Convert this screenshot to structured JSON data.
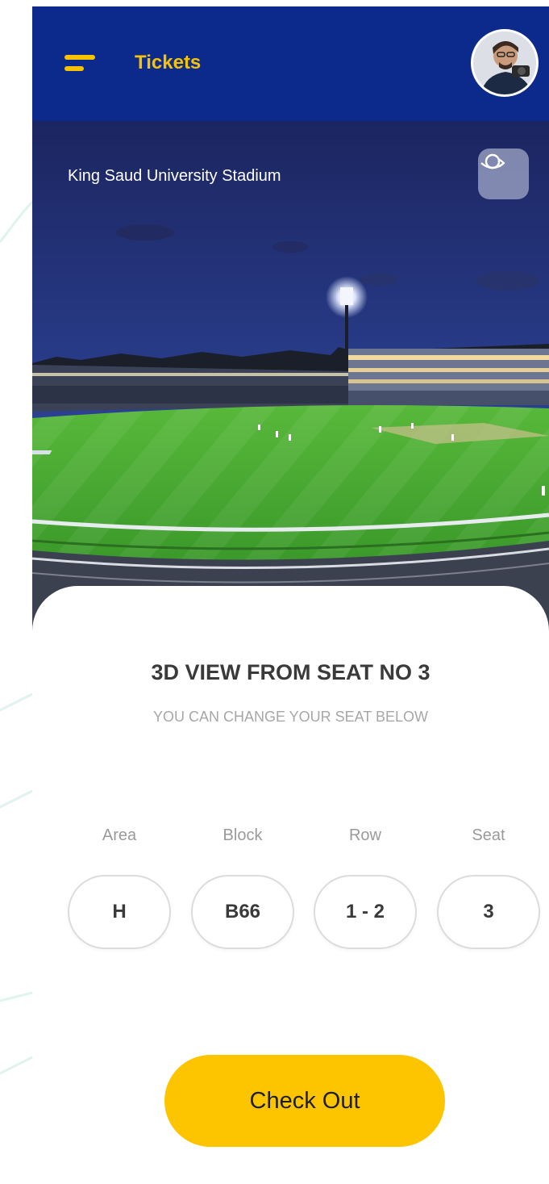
{
  "header": {
    "title": "Tickets"
  },
  "hero": {
    "stadium_name": "King Saud University Stadium"
  },
  "seat_view": {
    "title": "3D VIEW FROM SEAT NO 3",
    "subtitle": "YOU CAN CHANGE YOUR SEAT BELOW"
  },
  "selectors": [
    {
      "label": "Area",
      "value": "H"
    },
    {
      "label": "Block",
      "value": "B66"
    },
    {
      "label": "Row",
      "value": "1 - 2"
    },
    {
      "label": "Seat",
      "value": "3"
    }
  ],
  "checkout": {
    "label": "Check Out"
  },
  "colors": {
    "header_bg": "#0c2a8c",
    "accent": "#f7c300",
    "button": "#fdc500",
    "pitch": "#3d9a2a",
    "sky": "#1a2a6a"
  },
  "icons": {
    "menu": "menu-icon",
    "avatar": "avatar",
    "view_360": "rotate-360-icon"
  }
}
